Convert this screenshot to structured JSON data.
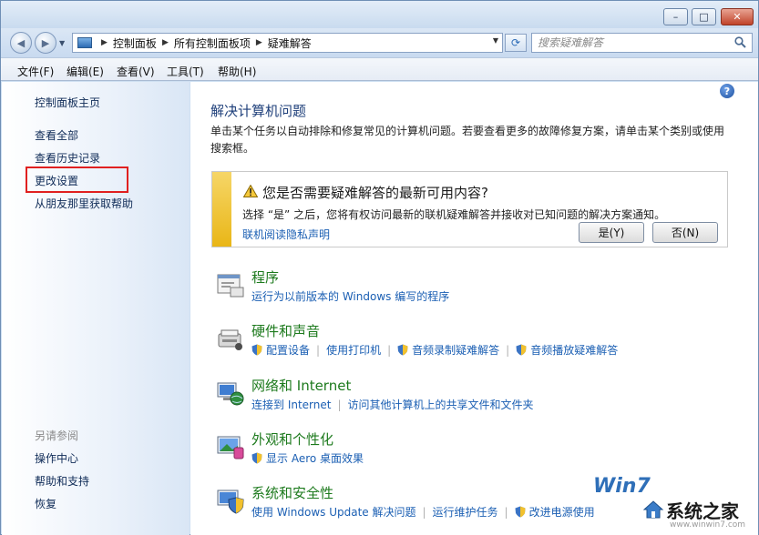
{
  "window": {
    "minimize_label": "–",
    "maximize_label": "□",
    "close_label": "✕"
  },
  "address": {
    "crumbs": [
      "控制面板",
      "所有控制面板项",
      "疑难解答"
    ],
    "search_placeholder": "搜索疑难解答"
  },
  "menu": [
    "文件(F)",
    "编辑(E)",
    "查看(V)",
    "工具(T)",
    "帮助(H)"
  ],
  "sidebar": {
    "home": "控制面板主页",
    "links": [
      "查看全部",
      "查看历史记录",
      "更改设置",
      "从朋友那里获取帮助"
    ],
    "see_also_heading": "另请参阅",
    "see_also": [
      "操作中心",
      "帮助和支持",
      "恢复"
    ]
  },
  "main": {
    "title": "解决计算机问题",
    "description": "单击某个任务以自动排除和修复常见的计算机问题。若要查看更多的故障修复方案，请单击某个类别或使用搜索框。",
    "notice": {
      "title": "您是否需要疑难解答的最新可用内容?",
      "text": "选择 “是” 之后，您将有权访问最新的联机疑难解答并接收对已知问题的解决方案通知。",
      "privacy_link": "联机阅读隐私声明",
      "yes_label": "是(Y)",
      "no_label": "否(N)",
      "accent_color": "#f0c733"
    },
    "categories": [
      {
        "title": "程序",
        "icon": "programs-icon",
        "links": [
          {
            "text": "运行为以前版本的 Windows 编写的程序",
            "shield": false
          }
        ]
      },
      {
        "title": "硬件和声音",
        "icon": "hardware-sound-icon",
        "links": [
          {
            "text": "配置设备",
            "shield": true
          },
          {
            "text": "使用打印机",
            "shield": false
          },
          {
            "text": "音频录制疑难解答",
            "shield": true
          },
          {
            "text": "音频播放疑难解答",
            "shield": true
          }
        ]
      },
      {
        "title": "网络和 Internet",
        "icon": "network-internet-icon",
        "links": [
          {
            "text": "连接到 Internet",
            "shield": false
          },
          {
            "text": "访问其他计算机上的共享文件和文件夹",
            "shield": false
          }
        ]
      },
      {
        "title": "外观和个性化",
        "icon": "appearance-icon",
        "links": [
          {
            "text": "显示 Aero 桌面效果",
            "shield": true
          }
        ]
      },
      {
        "title": "系统和安全性",
        "icon": "system-security-icon",
        "links": [
          {
            "text": "使用 Windows Update 解决问题",
            "shield": false
          },
          {
            "text": "运行维护任务",
            "shield": false
          },
          {
            "text": "改进电源使用",
            "shield": true
          }
        ]
      }
    ]
  },
  "watermark": {
    "logo": "Win7",
    "site_name": "系统之家",
    "url": "www.winwin7.com"
  },
  "colors": {
    "link": "#1b5fb3",
    "category_title": "#1d7a1d",
    "highlight_box": "#e02020"
  }
}
